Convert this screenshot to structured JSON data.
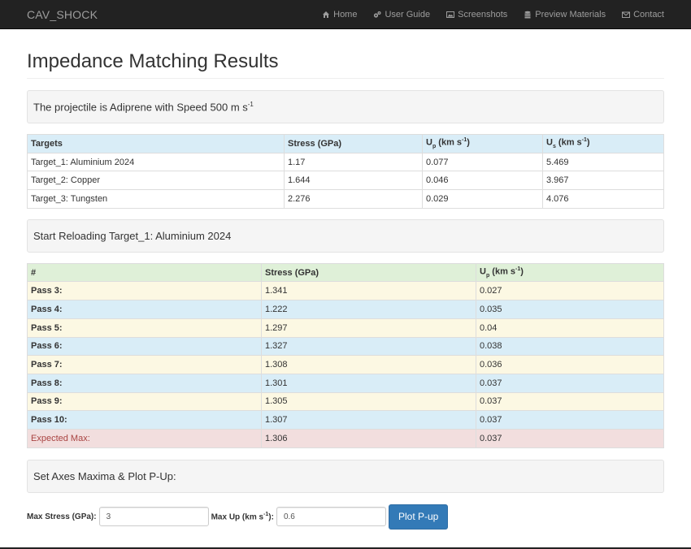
{
  "navbar": {
    "brand": "CAV_SHOCK",
    "items": [
      {
        "label": "Home",
        "icon": "home-icon"
      },
      {
        "label": "User Guide",
        "icon": "gears-icon"
      },
      {
        "label": "Screenshots",
        "icon": "image-icon"
      },
      {
        "label": "Preview Materials",
        "icon": "database-icon"
      },
      {
        "label": "Contact",
        "icon": "envelope-icon"
      }
    ]
  },
  "page": {
    "title": "Impedance Matching Results",
    "projectile_prefix": "The projectile is Adiprene with Speed 500 m s",
    "projectile_sup": "-1",
    "reload_text": "Start Reloading Target_1: Aluminium 2024",
    "axes_text": "Set Axes Maxima & Plot P-Up:"
  },
  "targets_table": {
    "headers": {
      "targets": "Targets",
      "stress": "Stress (GPa)",
      "up_base": "U",
      "up_sub": "p",
      "up_unit": " (km s",
      "up_sup": "-1",
      "up_close": ")",
      "us_base": "U",
      "us_sub": "s",
      "us_unit": " (km s",
      "us_sup": "-1",
      "us_close": ")"
    },
    "rows": [
      {
        "target": "Target_1: Aluminium 2024",
        "stress": "1.17",
        "up": "0.077",
        "us": "5.469"
      },
      {
        "target": "Target_2: Copper",
        "stress": "1.644",
        "up": "0.046",
        "us": "3.967"
      },
      {
        "target": "Target_3: Tungsten",
        "stress": "2.276",
        "up": "0.029",
        "us": "4.076"
      }
    ]
  },
  "passes_table": {
    "headers": {
      "num": "#",
      "stress": "Stress (GPa)",
      "up_base": "U",
      "up_sub": "p",
      "up_unit": " (km s",
      "up_sup": "-1",
      "up_close": ")"
    },
    "rows": [
      {
        "label": "Pass 3:",
        "stress": "1.341",
        "up": "0.027"
      },
      {
        "label": "Pass 4:",
        "stress": "1.222",
        "up": "0.035"
      },
      {
        "label": "Pass 5:",
        "stress": "1.297",
        "up": "0.04"
      },
      {
        "label": "Pass 6:",
        "stress": "1.327",
        "up": "0.038"
      },
      {
        "label": "Pass 7:",
        "stress": "1.308",
        "up": "0.036"
      },
      {
        "label": "Pass 8:",
        "stress": "1.301",
        "up": "0.037"
      },
      {
        "label": "Pass 9:",
        "stress": "1.305",
        "up": "0.037"
      },
      {
        "label": "Pass 10:",
        "stress": "1.307",
        "up": "0.037"
      }
    ],
    "expected": {
      "label": "Expected Max:",
      "stress": "1.306",
      "up": "0.037"
    }
  },
  "form": {
    "max_stress_label": "Max Stress (GPa):",
    "max_stress_value": "3",
    "max_up_label_prefix": "Max Up (km s",
    "max_up_label_sup": "-1",
    "max_up_label_suffix": "):",
    "max_up_value": "0.6",
    "plot_button": "Plot P-up"
  }
}
